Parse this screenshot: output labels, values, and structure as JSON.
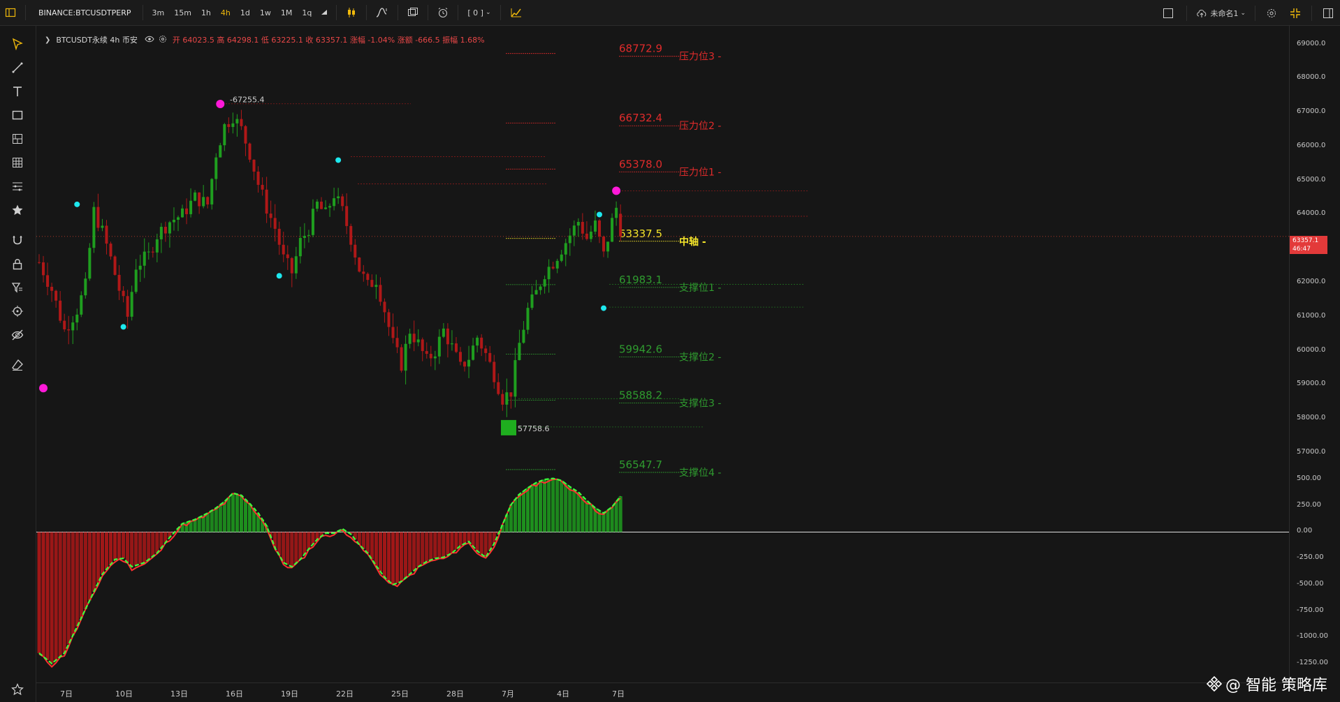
{
  "toolbar": {
    "symbol": "BINANCE:BTCUSDTPERP",
    "intervals": [
      "3m",
      "15m",
      "1h",
      "4h",
      "1d",
      "1w",
      "1M",
      "1q"
    ],
    "active_interval": "4h",
    "bracket_label": "[ 0 ]",
    "layout_name": "未命名1"
  },
  "legend": {
    "title": "BTCUSDT永续  4h  币安",
    "ohlc": "开 64023.5  高 64298.1  低 63225.1  收 63357.1  涨幅 -1.04%  涨额 -666.5  振幅 1.68%"
  },
  "levels": [
    {
      "price": "68772.9",
      "name": "压力位3",
      "value": 68772.9,
      "color": "#e02b2b"
    },
    {
      "price": "66732.4",
      "name": "压力位2",
      "value": 66732.4,
      "color": "#e02b2b"
    },
    {
      "price": "65378.0",
      "name": "压力位1",
      "value": 65378.0,
      "color": "#e02b2b"
    },
    {
      "price": "63337.5",
      "name": "中轴",
      "value": 63337.5,
      "color": "#f5e62a"
    },
    {
      "price": "61983.1",
      "name": "支撑位1",
      "value": 61983.1,
      "color": "#2f9b2f"
    },
    {
      "price": "59942.6",
      "name": "支撑位2",
      "value": 59942.6,
      "color": "#2f9b2f"
    },
    {
      "price": "58588.2",
      "name": "支撑位3",
      "value": 58588.2,
      "color": "#2f9b2f"
    },
    {
      "price": "56547.7",
      "name": "支撑位4",
      "value": 56547.7,
      "color": "#2f9b2f"
    }
  ],
  "annotations": {
    "high_label": "67255.4",
    "low_label": "57758.6"
  },
  "price_axis": {
    "main": [
      "69000.0",
      "68000.0",
      "67000.0",
      "66000.0",
      "65000.0",
      "64000.0",
      "63000.0",
      "62000.0",
      "61000.0",
      "60000.0",
      "59000.0",
      "58000.0",
      "57000.0"
    ],
    "indicator": [
      "500.00",
      "250.00",
      "0.00",
      "-250.00",
      "-500.00",
      "-750.00",
      "-1000.00",
      "-1250.00"
    ],
    "current_price": "63357.1",
    "countdown": "46:47"
  },
  "time_axis": [
    "7日",
    "10日",
    "13日",
    "16日",
    "19日",
    "22日",
    "25日",
    "28日",
    "7月",
    "4日",
    "7日"
  ],
  "watermark": "@ 智能 策略库",
  "colors": {
    "up": "#1f9e1f",
    "down": "#b01818",
    "resistance": "#e02b2b",
    "support": "#2f9b2f",
    "pivot": "#f5e62a",
    "accent": "#f0b90b",
    "marker_magenta": "#ff19d8",
    "marker_cyan": "#1ee8ee"
  },
  "chart_data": {
    "type": "candlestick",
    "interval": "4h",
    "ohlc_last": {
      "open": 64023.5,
      "high": 64298.1,
      "low": 63225.1,
      "close": 63357.1
    },
    "ylim": [
      56300,
      69300
    ],
    "close_path": [
      [
        0,
        62600
      ],
      [
        3,
        61800
      ],
      [
        6,
        60600
      ],
      [
        9,
        61200
      ],
      [
        11,
        61900
      ],
      [
        13,
        64100
      ],
      [
        15,
        63500
      ],
      [
        17,
        62700
      ],
      [
        19,
        61800
      ],
      [
        21,
        61000
      ],
      [
        23,
        62500
      ],
      [
        26,
        62800
      ],
      [
        28,
        63400
      ],
      [
        31,
        63800
      ],
      [
        34,
        64000
      ],
      [
        37,
        64500
      ],
      [
        40,
        64300
      ],
      [
        42,
        65800
      ],
      [
        44,
        66600
      ],
      [
        46,
        66900
      ],
      [
        48,
        66500
      ],
      [
        50,
        65800
      ],
      [
        52,
        64900
      ],
      [
        54,
        64200
      ],
      [
        56,
        63600
      ],
      [
        58,
        62700
      ],
      [
        60,
        62300
      ],
      [
        62,
        63200
      ],
      [
        64,
        63600
      ],
      [
        66,
        64300
      ],
      [
        68,
        64000
      ],
      [
        70,
        64600
      ],
      [
        72,
        64100
      ],
      [
        74,
        63300
      ],
      [
        76,
        62400
      ],
      [
        78,
        61900
      ],
      [
        80,
        62100
      ],
      [
        82,
        61200
      ],
      [
        84,
        60200
      ],
      [
        86,
        59600
      ],
      [
        88,
        60600
      ],
      [
        90,
        60200
      ],
      [
        92,
        59700
      ],
      [
        94,
        60000
      ],
      [
        96,
        60600
      ],
      [
        98,
        60100
      ],
      [
        100,
        59500
      ],
      [
        102,
        59800
      ],
      [
        104,
        60400
      ],
      [
        106,
        59900
      ],
      [
        108,
        59300
      ],
      [
        110,
        58600
      ],
      [
        112,
        58800
      ],
      [
        114,
        60200
      ],
      [
        116,
        61200
      ],
      [
        118,
        61700
      ],
      [
        120,
        62300
      ],
      [
        122,
        62600
      ],
      [
        124,
        63000
      ],
      [
        126,
        63400
      ],
      [
        128,
        63800
      ],
      [
        130,
        63300
      ],
      [
        132,
        63700
      ],
      [
        134,
        62800
      ],
      [
        136,
        63800
      ],
      [
        137,
        64200
      ],
      [
        138,
        63357
      ]
    ],
    "pivot_markers": [
      {
        "index": 1,
        "price": 58900,
        "color": "magenta"
      },
      {
        "index": 9,
        "price": 64300,
        "color": "cyan"
      },
      {
        "index": 20,
        "price": 60700,
        "color": "cyan"
      },
      {
        "index": 43,
        "price": 67250,
        "color": "magenta"
      },
      {
        "index": 57,
        "price": 62200,
        "color": "cyan"
      },
      {
        "index": 71,
        "price": 65600,
        "color": "cyan"
      },
      {
        "index": 133,
        "price": 64000,
        "color": "cyan"
      },
      {
        "index": 134,
        "price": 61250,
        "color": "cyan"
      },
      {
        "index": 137,
        "price": 64700,
        "color": "magenta"
      }
    ],
    "indicator": {
      "type": "histogram",
      "ylim": [
        -1350,
        600
      ],
      "path": [
        [
          0,
          -1150
        ],
        [
          3,
          -1250
        ],
        [
          6,
          -1150
        ],
        [
          9,
          -900
        ],
        [
          12,
          -650
        ],
        [
          15,
          -400
        ],
        [
          18,
          -260
        ],
        [
          20,
          -250
        ],
        [
          22,
          -330
        ],
        [
          25,
          -290
        ],
        [
          28,
          -200
        ],
        [
          31,
          -50
        ],
        [
          34,
          80
        ],
        [
          37,
          120
        ],
        [
          40,
          180
        ],
        [
          42,
          230
        ],
        [
          44,
          290
        ],
        [
          46,
          370
        ],
        [
          48,
          350
        ],
        [
          50,
          270
        ],
        [
          52,
          180
        ],
        [
          54,
          60
        ],
        [
          56,
          -150
        ],
        [
          58,
          -290
        ],
        [
          60,
          -330
        ],
        [
          62,
          -260
        ],
        [
          64,
          -160
        ],
        [
          66,
          -70
        ],
        [
          68,
          -10
        ],
        [
          70,
          -10
        ],
        [
          72,
          30
        ],
        [
          74,
          -20
        ],
        [
          76,
          -120
        ],
        [
          78,
          -200
        ],
        [
          80,
          -320
        ],
        [
          82,
          -430
        ],
        [
          84,
          -500
        ],
        [
          86,
          -470
        ],
        [
          88,
          -400
        ],
        [
          90,
          -330
        ],
        [
          92,
          -280
        ],
        [
          94,
          -250
        ],
        [
          96,
          -240
        ],
        [
          98,
          -200
        ],
        [
          100,
          -130
        ],
        [
          102,
          -90
        ],
        [
          104,
          -180
        ],
        [
          106,
          -240
        ],
        [
          108,
          -110
        ],
        [
          110,
          70
        ],
        [
          112,
          260
        ],
        [
          114,
          360
        ],
        [
          116,
          420
        ],
        [
          118,
          470
        ],
        [
          120,
          500
        ],
        [
          122,
          510
        ],
        [
          124,
          490
        ],
        [
          126,
          430
        ],
        [
          128,
          380
        ],
        [
          130,
          300
        ],
        [
          132,
          230
        ],
        [
          134,
          180
        ],
        [
          136,
          240
        ],
        [
          138,
          340
        ]
      ]
    }
  }
}
